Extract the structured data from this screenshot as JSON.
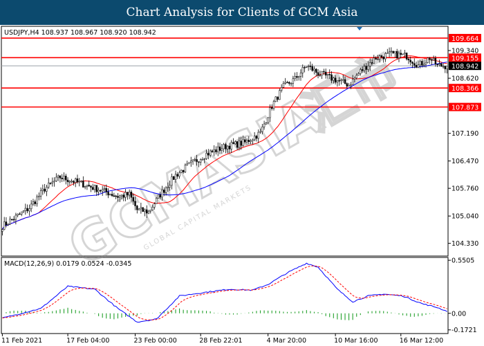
{
  "banner": {
    "title": "Chart Analysis for Clients of GCM Asia"
  },
  "watermark": {
    "text": "GCMASIA",
    "chinese": "汇市",
    "tagline": "GLOBAL CAPITAL MARKETS"
  },
  "chart_data": [
    {
      "type": "candlestick",
      "panel": "price",
      "symbol": "USDJPY,H4",
      "ohlc_header": "USDJPY,H4  108.937 108.967 108.920 108.942",
      "ylim": [
        104.0,
        109.97
      ],
      "y_ticks": [
        "109.340",
        "108.620",
        "107.190",
        "106.470",
        "105.760",
        "105.040",
        "104.330"
      ],
      "y_tick_values": [
        109.34,
        108.62,
        107.19,
        106.47,
        105.76,
        105.04,
        104.33
      ],
      "x_ticks": [
        "11 Feb 2021",
        "17 Feb 04:00",
        "23 Feb 00:00",
        "28 Feb 22:01",
        "4 Mar 20:00",
        "10 Mar 16:00",
        "16 Mar 12:00"
      ],
      "x_tick_bars": [
        0,
        34,
        69,
        103,
        138,
        173,
        207
      ],
      "n_bars": 232,
      "current_price": {
        "value": 108.942,
        "label": "108.942"
      },
      "levels": [
        {
          "value": 109.664,
          "label": "109.664",
          "color": "#ff0000"
        },
        {
          "value": 109.155,
          "label": "109.155",
          "color": "#ff0000"
        },
        {
          "value": 108.366,
          "label": "108.366",
          "color": "#ff0000"
        },
        {
          "value": 107.873,
          "label": "107.873",
          "color": "#ff0000"
        }
      ],
      "close_anchors": [
        [
          0,
          104.78
        ],
        [
          8,
          105.05
        ],
        [
          14,
          105.25
        ],
        [
          22,
          105.75
        ],
        [
          30,
          106.05
        ],
        [
          40,
          105.9
        ],
        [
          52,
          105.7
        ],
        [
          60,
          105.55
        ],
        [
          66,
          105.6
        ],
        [
          70,
          105.2
        ],
        [
          76,
          105.15
        ],
        [
          82,
          105.6
        ],
        [
          90,
          106.1
        ],
        [
          98,
          106.4
        ],
        [
          106,
          106.65
        ],
        [
          116,
          106.85
        ],
        [
          126,
          106.95
        ],
        [
          134,
          107.2
        ],
        [
          140,
          107.9
        ],
        [
          146,
          108.4
        ],
        [
          152,
          108.6
        ],
        [
          158,
          108.95
        ],
        [
          164,
          108.75
        ],
        [
          172,
          108.6
        ],
        [
          180,
          108.45
        ],
        [
          186,
          108.8
        ],
        [
          194,
          109.15
        ],
        [
          202,
          109.25
        ],
        [
          210,
          109.2
        ],
        [
          216,
          108.95
        ],
        [
          222,
          109.15
        ],
        [
          226,
          108.95
        ],
        [
          231,
          108.94
        ]
      ],
      "colors": {
        "up": "#000000",
        "down": "#000000",
        "up_fill": "#ffffff",
        "down_fill": "#000000",
        "ma_fast": "#ff0000",
        "ma_slow": "#0000ff"
      }
    },
    {
      "type": "macd",
      "panel": "indicator",
      "params": "MACD(12,26,9)",
      "header": "MACD(12,26,9) 0.0179 0.0524 -0.0345",
      "values": {
        "main": 0.0179,
        "signal": 0.0524,
        "histogram": -0.0345
      },
      "ylim": [
        -0.21,
        0.58
      ],
      "y_ticks": [
        "0.5505",
        "0.00",
        "-0.1721"
      ],
      "y_tick_values": [
        0.5505,
        0.0,
        -0.1721
      ],
      "main_anchors": [
        [
          0,
          -0.05
        ],
        [
          20,
          0.05
        ],
        [
          34,
          0.28
        ],
        [
          48,
          0.25
        ],
        [
          60,
          0.05
        ],
        [
          70,
          -0.09
        ],
        [
          80,
          -0.06
        ],
        [
          92,
          0.18
        ],
        [
          106,
          0.22
        ],
        [
          118,
          0.25
        ],
        [
          130,
          0.24
        ],
        [
          138,
          0.3
        ],
        [
          148,
          0.42
        ],
        [
          158,
          0.52
        ],
        [
          164,
          0.48
        ],
        [
          174,
          0.25
        ],
        [
          182,
          0.12
        ],
        [
          190,
          0.18
        ],
        [
          198,
          0.2
        ],
        [
          208,
          0.18
        ],
        [
          218,
          0.1
        ],
        [
          226,
          0.06
        ],
        [
          231,
          0.02
        ]
      ],
      "colors": {
        "main": "#0000ff",
        "signal": "#ff0000",
        "histogram": "#22a02a"
      }
    }
  ]
}
